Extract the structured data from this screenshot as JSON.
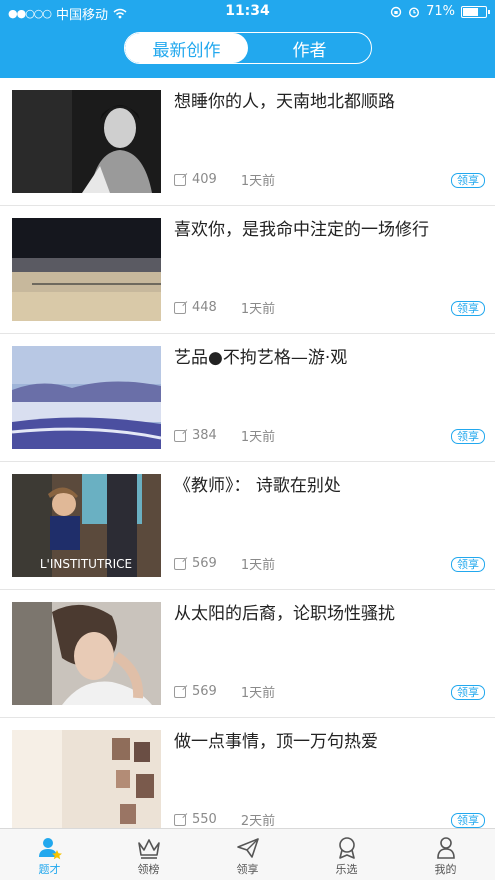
{
  "status": {
    "carrier": "中国移动",
    "time": "11:34",
    "battery": "71%",
    "battery_level": 0.71
  },
  "header": {
    "tab_active": "最新创作",
    "tab_inactive": "作者"
  },
  "feed": [
    {
      "title": "想睡你的人，天南地北都顺路",
      "count": "409",
      "time": "1天前",
      "tag": "领享"
    },
    {
      "title": "喜欢你，是我命中注定的一场修行",
      "count": "448",
      "time": "1天前",
      "tag": "领享"
    },
    {
      "title": "艺品●不拘艺格—游·观",
      "count": "384",
      "time": "1天前",
      "tag": "领享"
    },
    {
      "title": "《教师》： 诗歌在别处",
      "count": "569",
      "time": "1天前",
      "tag": "领享",
      "poster_text": "L'INSTITUTRICE"
    },
    {
      "title": "从太阳的后裔，论职场性骚扰",
      "count": "569",
      "time": "1天前",
      "tag": "领享"
    },
    {
      "title": "做一点事情，顶一万句热爱",
      "count": "550",
      "time": "2天前",
      "tag": "领享"
    }
  ],
  "tabs": [
    {
      "label": "题才",
      "icon": "user-star-icon"
    },
    {
      "label": "领榜",
      "icon": "crown-icon"
    },
    {
      "label": "领享",
      "icon": "paper-plane-icon"
    },
    {
      "label": "乐选",
      "icon": "badge-icon"
    },
    {
      "label": "我的",
      "icon": "person-icon"
    }
  ],
  "colors": {
    "accent": "#22a8ee"
  }
}
